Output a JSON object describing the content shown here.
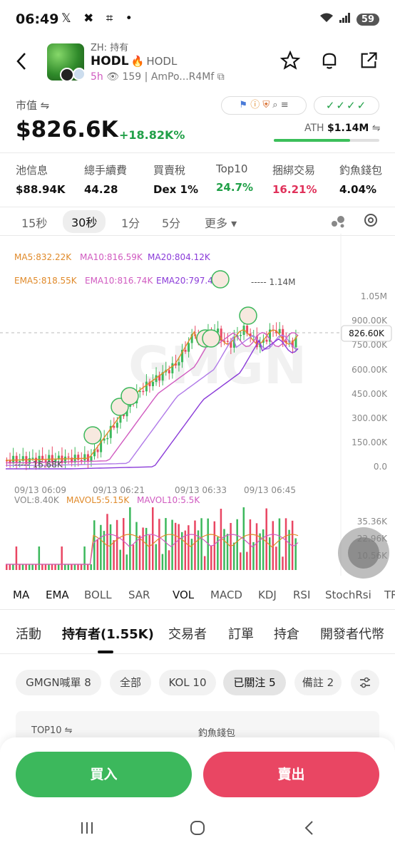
{
  "status_bar": {
    "time": "06:49",
    "icons_left": "𝕏 ✖ ⌗ •",
    "signal": "6",
    "battery": "59"
  },
  "header": {
    "sub_label": "ZH: 持有",
    "token_name": "HODL",
    "token_symbol": "HODL",
    "age": "5h",
    "views": "159",
    "address": "AmPo...R4Mf"
  },
  "market": {
    "label": "市值 ⇋",
    "value": "$826.6K",
    "change": "+18.82K%",
    "ath_label": "ATH",
    "ath_value": "$1.14M",
    "ath_progress": 0.72,
    "check_badge": "✓✓✓✓"
  },
  "stats": [
    {
      "label": "池信息",
      "value": "$88.94K",
      "color": "#111111"
    },
    {
      "label": "總手續費",
      "value": "44.28",
      "color": "#111111"
    },
    {
      "label": "買賣稅",
      "value": "Dex 1%",
      "color": "#111111"
    },
    {
      "label": "Top10",
      "value": "24.7%",
      "color": "#21a048"
    },
    {
      "label": "捆綁交易",
      "value": "16.21%",
      "color": "#e0315a"
    },
    {
      "label": "釣魚錢包",
      "value": "4.04%",
      "color": "#111111"
    }
  ],
  "timeframes": [
    "15秒",
    "30秒",
    "1分",
    "5分",
    "更多 ▾"
  ],
  "active_timeframe": "30秒",
  "chart_data": {
    "type": "candlestick",
    "legend_ma": [
      "MA5:832.22K",
      "MA10:816.59K",
      "MA20:804.12K"
    ],
    "legend_ema": [
      "EMA5:818.55K",
      "EMA10:816.74K",
      "EMA20:797.4"
    ],
    "y_ticks": [
      "1.05M",
      "900.00K",
      "750.00K",
      "600.00K",
      "450.00K",
      "300.00K",
      "150.00K",
      "0.0"
    ],
    "current_price_label": "826.60K",
    "high_label": "1.14M",
    "low_label": "16.68K",
    "x_ticks": [
      "09/13 06:09",
      "09/13 06:21",
      "09/13 06:33",
      "09/13 06:45"
    ],
    "vol_legend": [
      "VOL:8.40K",
      "MAVOL5:5.15K",
      "MAVOL10:5.5K"
    ],
    "vol_ticks": [
      "35.36K",
      "22.96K",
      "10.56K"
    ],
    "watermark": "GMGN"
  },
  "indicators": [
    "MA",
    "EMA",
    "BOLL",
    "SAR",
    "VOL",
    "MACD",
    "KDJ",
    "RSI",
    "StochRsi",
    "TR"
  ],
  "tabs": [
    "活動",
    "持有者(1.55K)",
    "交易者",
    "訂單",
    "持倉",
    "開發者代幣"
  ],
  "chips": [
    "GMGN喊單 8",
    "全部",
    "KOL 10",
    "已關注 5",
    "備註 2"
  ],
  "card": {
    "left": "TOP10 ⇋",
    "right": "釣魚錢包"
  },
  "actions": {
    "buy": "買入",
    "sell": "賣出"
  },
  "colors": {
    "green": "#3cb85c",
    "red": "#e94663",
    "accent": "#21a048"
  }
}
